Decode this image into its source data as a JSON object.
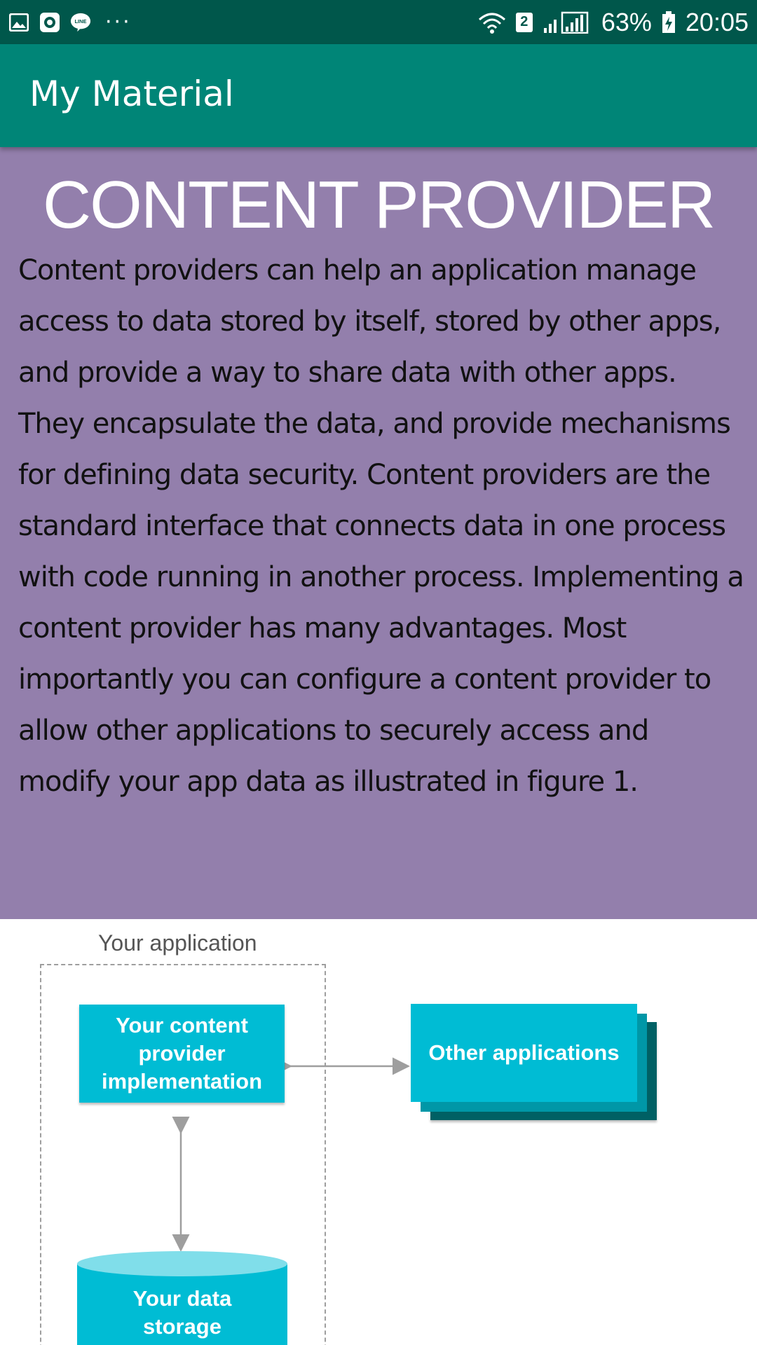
{
  "status_bar": {
    "left_icons": [
      "image-icon",
      "screenshot-icon",
      "line-app-icon"
    ],
    "more": "···",
    "sim_slot": "2",
    "battery": "63%",
    "time": "20:05",
    "color": "#00574b"
  },
  "app_bar": {
    "title": "My Material",
    "color": "#008577"
  },
  "content": {
    "heading": "CONTENT PROVIDER",
    "body": "Content providers can help an application manage access to data stored by itself, stored by other apps, and provide a way to share data with other apps. They encapsulate the data, and provide mechanisms for defining data security. Content providers are the standard interface that connects data in one process with code running in another process. Implementing a content provider has many advantages. Most importantly you can configure a content provider to allow other applications to securely access and modify your app data as illustrated in figure 1.",
    "background": "#937fac"
  },
  "figure": {
    "app_label": "Your application",
    "provider_lines": [
      "Your content",
      "provider",
      "implementation"
    ],
    "other_apps": "Other applications",
    "storage_lines": [
      "Your data",
      "storage"
    ],
    "box_color": "#00bcd4"
  }
}
